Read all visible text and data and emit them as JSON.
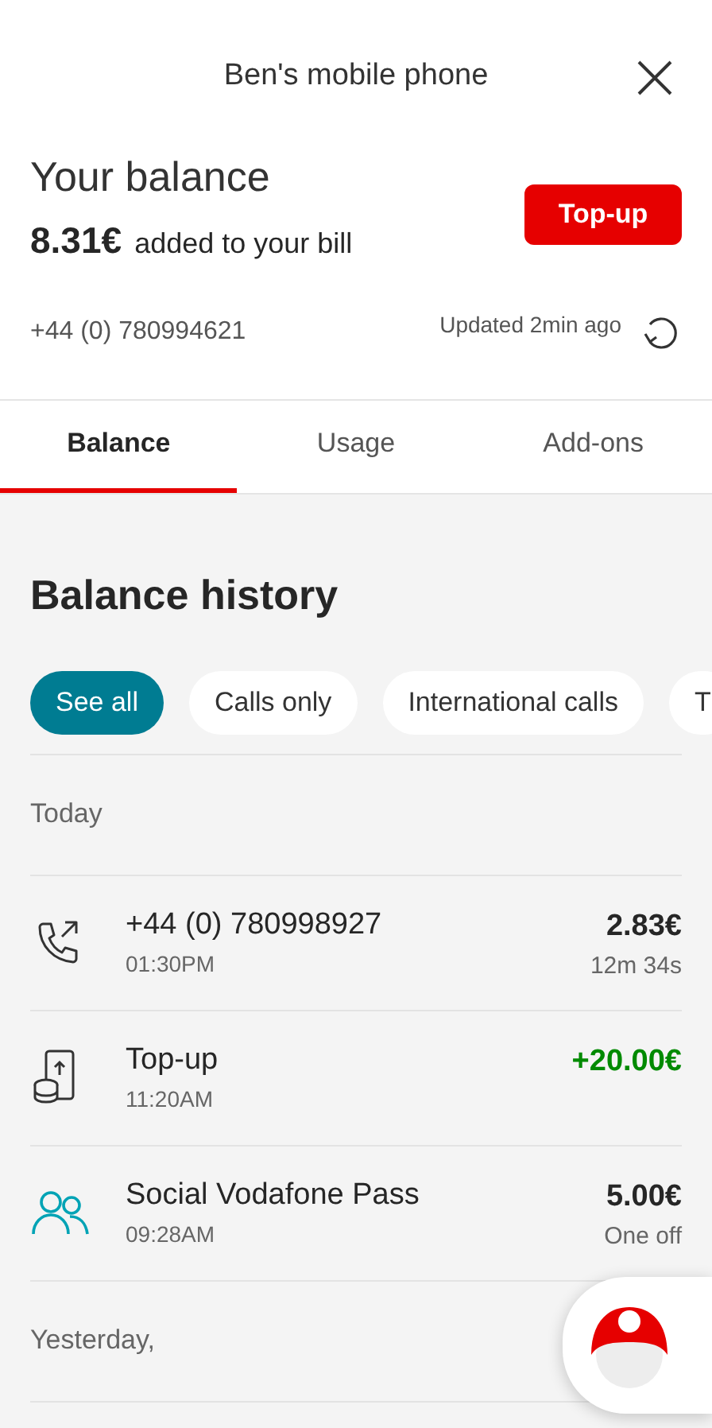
{
  "header": {
    "title": "Ben's mobile phone"
  },
  "balance": {
    "heading": "Your balance",
    "amount": "8.31€",
    "note": "added to your bill",
    "number": "+44 (0) 780994621",
    "updated": "Updated 2min ago",
    "button": "Top-up"
  },
  "tabs": [
    {
      "label": "Balance",
      "selected": true
    },
    {
      "label": "Usage",
      "selected": false
    },
    {
      "label": "Add-ons",
      "selected": false
    }
  ],
  "history": {
    "title": "Balance history",
    "filters": [
      {
        "label": "See all",
        "selected": true
      },
      {
        "label": "Calls only",
        "selected": false
      },
      {
        "label": "International calls",
        "selected": false
      },
      {
        "label": "T",
        "selected": false
      }
    ],
    "groups": [
      {
        "label": "Today",
        "items": [
          {
            "kind": "call",
            "name": "+44 (0) 780998927",
            "time": "01:30PM",
            "amount": "2.83€",
            "credit": false,
            "detail": "12m 34s"
          },
          {
            "kind": "topup",
            "name": "Top-up",
            "time": "11:20AM",
            "amount": "+20.00€",
            "credit": true
          },
          {
            "kind": "pass",
            "name": "Social Vodafone Pass",
            "time": "09:28AM",
            "amount": "5.00€",
            "credit": false,
            "detail": "One off"
          }
        ]
      },
      {
        "label": "Yesterday,"
      }
    ]
  }
}
